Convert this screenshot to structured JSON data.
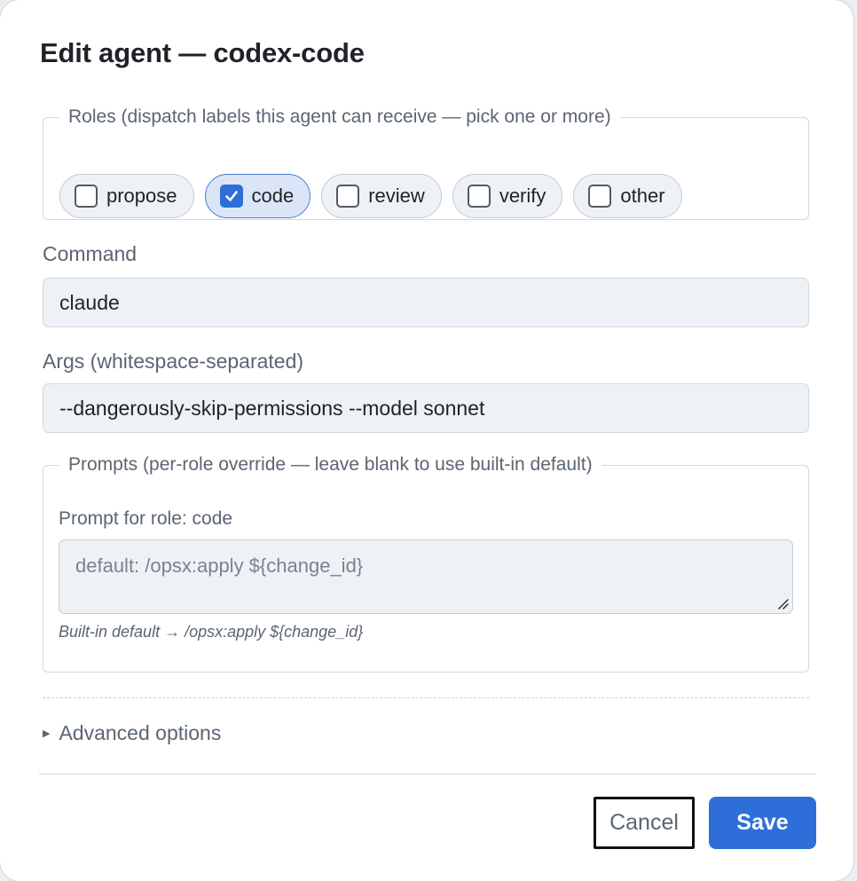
{
  "dialog": {
    "title": "Edit agent — codex-code"
  },
  "roles": {
    "legend": "Roles (dispatch labels this agent can receive — pick one or more)",
    "options": [
      {
        "label": "propose",
        "checked": false
      },
      {
        "label": "code",
        "checked": true
      },
      {
        "label": "review",
        "checked": false
      },
      {
        "label": "verify",
        "checked": false
      },
      {
        "label": "other",
        "checked": false
      }
    ]
  },
  "command": {
    "label": "Command",
    "value": "claude"
  },
  "args": {
    "label": "Args (whitespace-separated)",
    "value": "--dangerously-skip-permissions --model sonnet"
  },
  "prompts": {
    "legend": "Prompts (per-role override — leave blank to use built-in default)",
    "role_label": "Prompt for role: code",
    "placeholder": "default: /opsx:apply ${change_id}",
    "hint": "Built-in default → /opsx:apply ${change_id}"
  },
  "advanced": {
    "label": "Advanced options"
  },
  "footer": {
    "cancel_label": "Cancel",
    "save_label": "Save"
  },
  "colors": {
    "accent": "#2e6ed8",
    "checked_chip_bg": "#dbe5f7",
    "input_bg": "#eef2f7"
  }
}
